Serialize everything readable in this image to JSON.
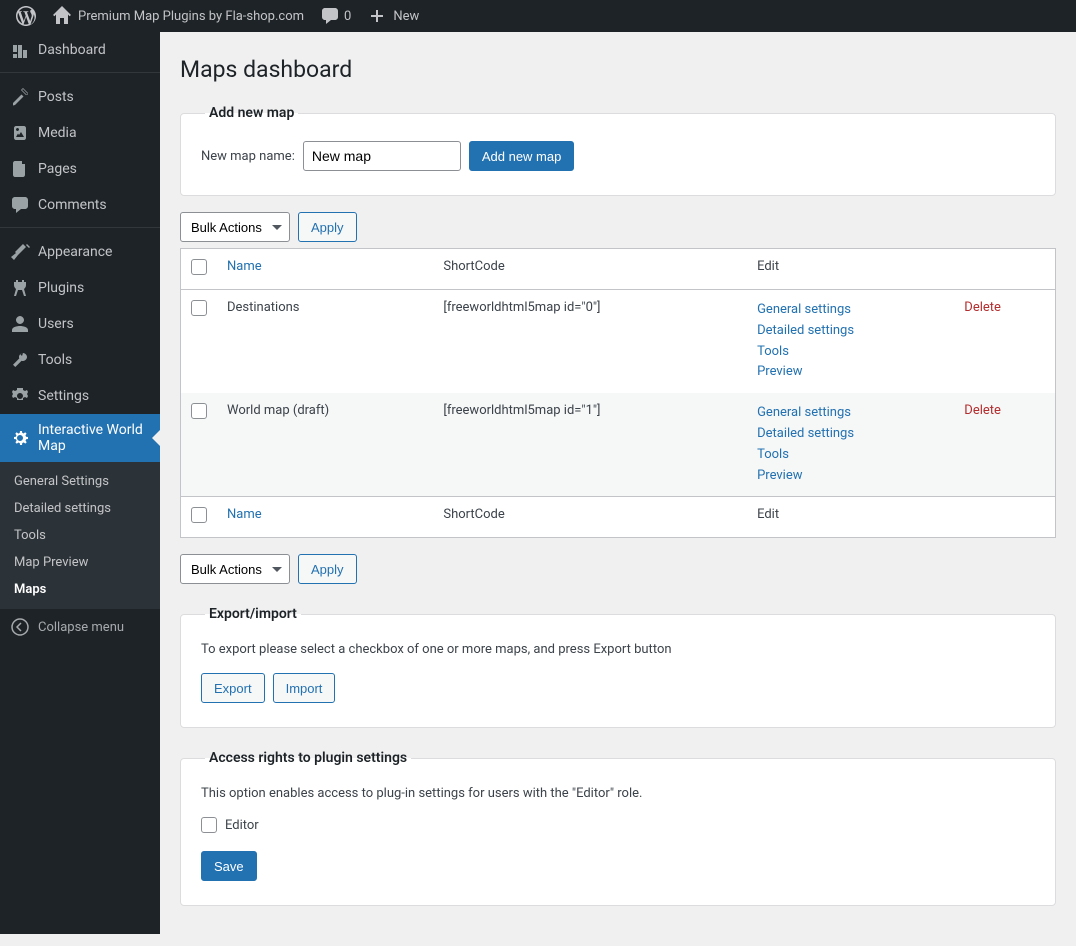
{
  "adminbar": {
    "site_title": "Premium Map Plugins by Fla-shop.com",
    "comments_count": "0",
    "new_label": "New"
  },
  "sidebar": {
    "items": [
      {
        "label": "Dashboard"
      },
      {
        "label": "Posts"
      },
      {
        "label": "Media"
      },
      {
        "label": "Pages"
      },
      {
        "label": "Comments"
      },
      {
        "label": "Appearance"
      },
      {
        "label": "Plugins"
      },
      {
        "label": "Users"
      },
      {
        "label": "Tools"
      },
      {
        "label": "Settings"
      },
      {
        "label": "Interactive World Map"
      }
    ],
    "submenu": [
      {
        "label": "General Settings"
      },
      {
        "label": "Detailed settings"
      },
      {
        "label": "Tools"
      },
      {
        "label": "Map Preview"
      },
      {
        "label": "Maps"
      }
    ],
    "collapse_label": "Collapse menu"
  },
  "page": {
    "title": "Maps dashboard"
  },
  "addnew": {
    "legend": "Add new map",
    "name_label": "New map name:",
    "name_value": "New map",
    "button": "Add new map"
  },
  "bulk": {
    "selected": "Bulk Actions",
    "apply": "Apply"
  },
  "table": {
    "cols": {
      "name": "Name",
      "shortcode": "ShortCode",
      "edit": "Edit"
    },
    "rows": [
      {
        "name": "Destinations",
        "shortcode": "[freeworldhtml5map id=\"0\"]"
      },
      {
        "name": "World map (draft)",
        "shortcode": "[freeworldhtml5map id=\"1\"]"
      }
    ],
    "edit_links": {
      "general": "General settings",
      "detailed": "Detailed settings",
      "tools": "Tools",
      "preview": "Preview"
    },
    "delete": "Delete"
  },
  "export": {
    "legend": "Export/import",
    "desc": "To export please select a checkbox of one or more maps, and press Export button",
    "export_btn": "Export",
    "import_btn": "Import"
  },
  "access": {
    "legend": "Access rights to plugin settings",
    "desc": "This option enables access to plug-in settings for users with the \"Editor\" role.",
    "editor_label": "Editor",
    "save_btn": "Save"
  }
}
